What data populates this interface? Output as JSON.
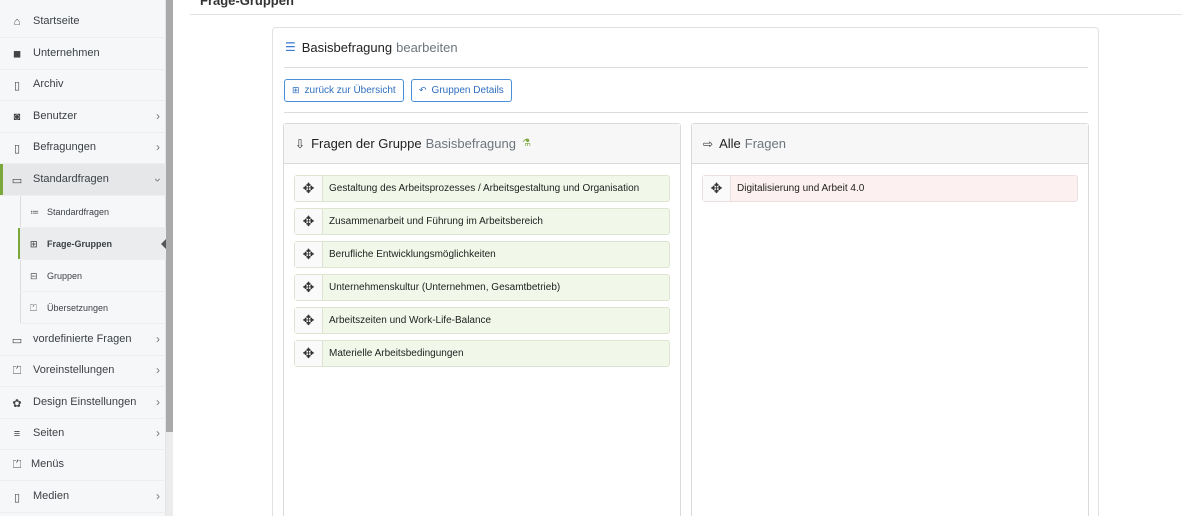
{
  "header": {
    "title": "Frage-Gruppen"
  },
  "sidebar": {
    "items": [
      {
        "label": "Startseite",
        "icon": "home-icon",
        "glyph": "⌂",
        "chevron": false
      },
      {
        "label": "Unternehmen",
        "icon": "building-icon",
        "glyph": "◼",
        "chevron": false
      },
      {
        "label": "Archiv",
        "icon": "file-icon",
        "glyph": "🗋",
        "chevron": false
      },
      {
        "label": "Benutzer",
        "icon": "user-icon",
        "glyph": "◙",
        "chevron": true
      },
      {
        "label": "Befragungen",
        "icon": "survey-icon",
        "glyph": "▯",
        "chevron": true
      },
      {
        "label": "Standardfragen",
        "icon": "folder-icon",
        "glyph": "▭",
        "chevron": true,
        "expanded": true
      },
      {
        "label": "vordefinierte Fragen",
        "icon": "folder-icon",
        "glyph": "▭",
        "chevron": true
      },
      {
        "label": "Voreinstellungen",
        "icon": "toolbox-icon",
        "glyph": "⏍",
        "chevron": true
      },
      {
        "label": "Design Einstellungen",
        "icon": "palette-icon",
        "glyph": "✿",
        "chevron": true
      },
      {
        "label": "Seiten",
        "icon": "list-icon",
        "glyph": "≡",
        "chevron": true
      },
      {
        "label": "Menüs",
        "icon": "toolbox-icon",
        "glyph": "⏍",
        "chevron": false
      },
      {
        "label": "Medien",
        "icon": "media-icon",
        "glyph": "▯",
        "chevron": true
      }
    ],
    "submenu": [
      {
        "label": "Standardfragen",
        "icon": "list-icon",
        "glyph": "≔"
      },
      {
        "label": "Frage-Gruppen",
        "icon": "grid-icon",
        "glyph": "⊞",
        "active": true
      },
      {
        "label": "Gruppen",
        "icon": "box-icon",
        "glyph": "⊟"
      },
      {
        "label": "Übersetzungen",
        "icon": "toolbox-icon",
        "glyph": "⏍"
      }
    ]
  },
  "card": {
    "title_strong": "Basisbefragung",
    "title_muted": "bearbeiten",
    "buttons": {
      "back": "zurück zur Übersicht",
      "details": "Gruppen Details"
    }
  },
  "left_panel": {
    "title_strong": "Fragen der Gruppe",
    "title_muted": "Basisbefragung",
    "items": [
      "Gestaltung des Arbeitsprozesses / Arbeitsgestaltung und Organisation",
      "Zusammenarbeit und Führung im Arbeitsbereich",
      "Berufliche Entwicklungsmöglichkeiten",
      "Unternehmenskultur (Unternehmen, Gesamtbetrieb)",
      "Arbeitszeiten und Work-Life-Balance",
      "Materielle Arbeitsbedingungen"
    ]
  },
  "right_panel": {
    "title_strong": "Alle",
    "title_muted": "Fragen",
    "items": [
      "Digitalisierung und Arbeit 4.0"
    ]
  },
  "colors": {
    "accent": "#7aa83a",
    "link": "#2f6fbf",
    "assigned_bg": "#f1f8e9",
    "available_bg": "#fdf0f0"
  }
}
